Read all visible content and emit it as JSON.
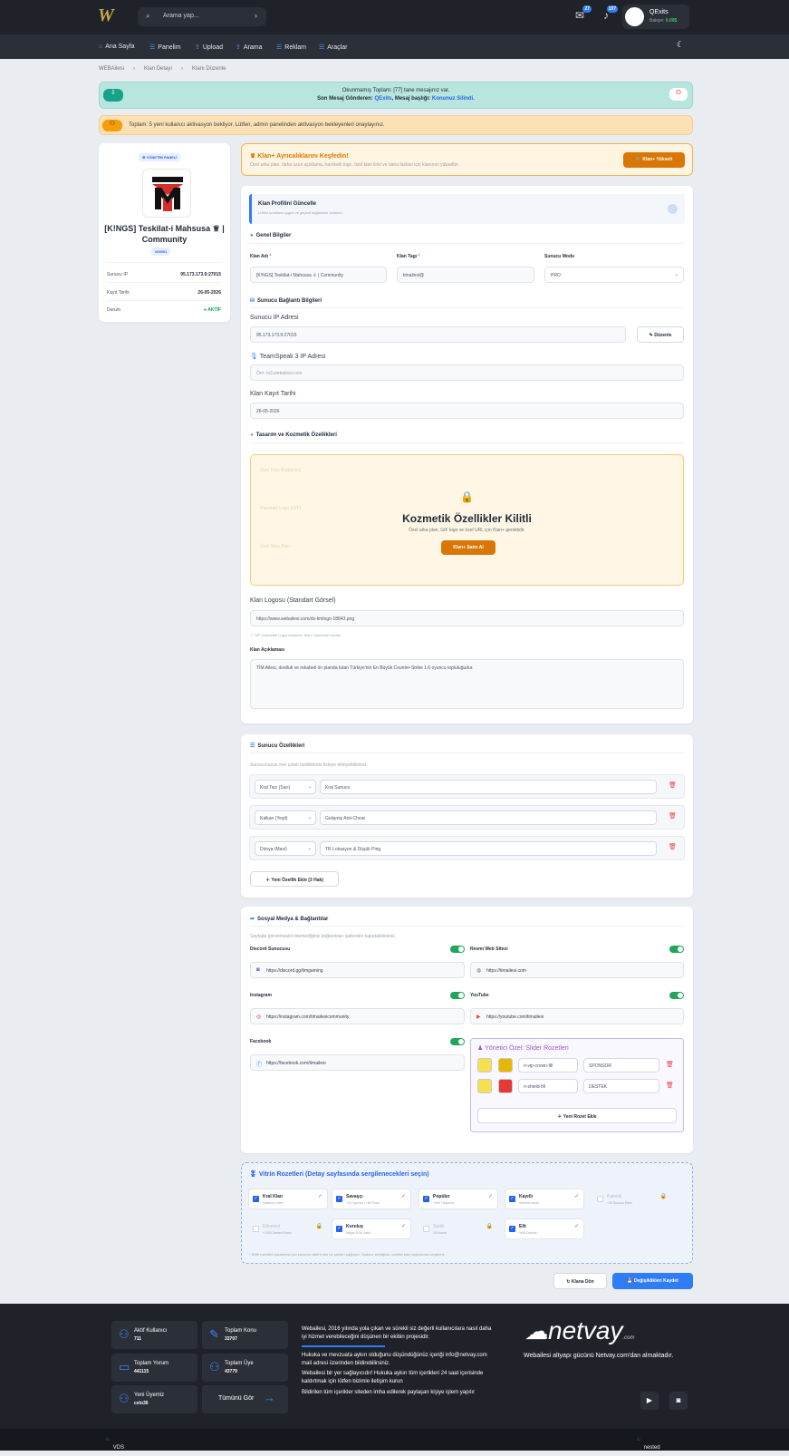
{
  "header": {
    "search_placeholder": "Arama yap...",
    "badge1": "27",
    "badge2": "197",
    "username": "QExits",
    "balance_label": "Bakiye:",
    "balance": "0.00$"
  },
  "nav": [
    "Ana Sayfa",
    "Panelim",
    "Upload",
    "Arama",
    "Reklam",
    "Araçlar"
  ],
  "breadcrumb": [
    "WEBAilesi",
    "Klan Detayı",
    "Klanı Düzenle"
  ],
  "alert_msg": {
    "line1": "Okunmamış Toplam: [77] tane mesajınız var.",
    "line2_prefix": "Son Mesaj Gönderen:",
    "sender": "QExits",
    "mid": ", Mesaj başlığı:",
    "title": "Konunuz Silindi."
  },
  "alert_activation": "Toplam: 5 yeni kullanıcı aktivasyon bekliyor. Lütfen, admin panelinden aktivasyon bekleyenleri onaylayınız.",
  "clan": {
    "panel_badge": "YÖNETİM PANELİ",
    "name": "[K!NGS] Teskilat-i Mahsusa ♕ | Community",
    "id_badge": "#00001",
    "rows": [
      {
        "k": "Sunucu IP",
        "v": "95.173.173.9:27015"
      },
      {
        "k": "Kayıt Tarihi",
        "v": "26-05-2026"
      },
      {
        "k": "Durum",
        "v": "AKTİF"
      }
    ]
  },
  "promo": {
    "title": "Klan+ Ayrıcalıklarını Keşfedin!",
    "sub": "Özel arka plan, daha uzun açıklama, hareketli logo, özel klan linki ve daha fazlası için klanınızı yükseltin.",
    "button": "Klan+ Yükselt"
  },
  "form": {
    "intro_title": "Klan Profilini Güncelle",
    "intro_sub": "Lütfen kurallara uygun ve geçerli bağlantılar kullanın.",
    "general": "Genel Bilgiler",
    "name_label": "Klan Adı",
    "name_value": "[K!NGS] Teskilat-i Mahsusa ♕ | Community",
    "tag_label": "Klan Tagı",
    "tag_value": "timailesi@",
    "mode_label": "Sunucu Modu",
    "mode_value": "PRO",
    "conn": "Sunucu Bağlantı Bilgileri",
    "ip_label": "Sunucu IP Adresi",
    "ip_value": "95.173.173.9:27015",
    "edit": "Düzenle",
    "ts_label": "TeamSpeak 3 IP Adresi",
    "ts_placeholder": "Örn: ts3.webailesi.com",
    "date_label": "Klan Kayıt Tarihi",
    "date_value": "26-05-2026",
    "design": "Tasarım ve Kozmetik Özellikleri",
    "ghost1": "Özel Klan Bağlantısı",
    "ghost2": "Hareketli Logo (GIF)",
    "ghost3": "Özel Arka Plan",
    "lock_title": "Kozmetik Özellikler Kilitli",
    "lock_sub": "Özel arka plan, GIF logo ve özel URL için Klan+ gereklidir.",
    "lock_button": "Klan+ Satın Al",
    "logo_label": "Klan Logosu (Standart Görsel)",
    "logo_value": "https://www.webailesi.com/ds-timlogo-18843.png",
    "logo_note": "ⓘ GIF (Hareketli Logo) kullanımı Klan+ üyelerine özeldir.",
    "desc_label": "Klan Açıklaması",
    "desc_value": "TİM Ailesi, dostluk ve rekabeti ön planda tutan Türkiye'nin En Büyük Counter-Strike 1.6 oyuncu topluluğudur."
  },
  "features": {
    "title": "Sunucu Özellikleri",
    "sub": "Sunucunuzun öne çıkan özelliklerini listeye ekleyebilirsiniz.",
    "items": [
      {
        "icon": "Kral Tacı (Sarı)",
        "text": "Kral Sunucu"
      },
      {
        "icon": "Kalkan (Yeşil)",
        "text": "Gelişmiş Anti-Cheat"
      },
      {
        "icon": "Dünya (Mavi)",
        "text": "TR Lokasyon & Düşük Ping"
      }
    ],
    "add": "Yeni Özellik Ekle (3 Hak)"
  },
  "social": {
    "title": "Sosyal Medya & Bağlantılar",
    "sub": "Sayfada görünmesini istemediğiniz bağlantıları şalterden kapatabilirsiniz.",
    "discord_label": "Discord Sunucusu",
    "discord": "https://discord.gg/timgaming",
    "web_label": "Resmi Web Sitesi",
    "web": "https://timailesi.com",
    "ig_label": "Instagram",
    "ig": "https://instagram.com/timailesicommunity",
    "yt_label": "YouTube",
    "yt": "https://youtube.com/timailesi",
    "fb_label": "Facebook",
    "fb": "https://facebook.com/timailesi",
    "admin_title": "Yönetici Özel: Slider Rozetleri",
    "badges": [
      {
        "icon": "ri-vip-crown-fill",
        "label": "SPONSOR",
        "c1": "#f5e050",
        "c2": "#e5b800"
      },
      {
        "icon": "ri-shield-fill",
        "label": "DESTEK",
        "c1": "#f5e050",
        "c2": "#e53935"
      }
    ],
    "add_badge": "Yeni Rozet Ekle"
  },
  "vitrin": {
    "title": "Vitrin Rozetleri (Detay sayfasında sergilenecekleri seçin)",
    "items": [
      {
        "n": "Kral Klan",
        "d": "Haftanın Lideri",
        "on": true
      },
      {
        "n": "Savaşçı",
        "d": "+20 Oyuncu / +80 Puan",
        "on": true
      },
      {
        "n": "Popüler",
        "d": "+900 Tıklanma",
        "on": true
      },
      {
        "n": "Kayıtlı",
        "d": "Sisteme tanıtıl",
        "on": true
      },
      {
        "n": "Kalemli",
        "d": "+40 Sunucu Etkin",
        "on": false
      },
      {
        "n": "Efsanevi",
        "d": "+1000 Destek Puanı",
        "on": false
      },
      {
        "n": "Kuruluş",
        "d": "Mayıs 2026 Sabit",
        "on": true
      },
      {
        "n": "Sadık",
        "d": "18 Kurum",
        "on": false
      },
      {
        "n": "Elit",
        "d": "%95 Doluluk",
        "on": true
      }
    ],
    "note": "* Kilitli rozetleri kazanmak için klanınızı aktif tutun ve şartları sağlayın. Sadece seçtiğiniz rozetler klan sayfanızda sergilenir."
  },
  "actions": {
    "back": "Klana Dön",
    "save": "Değişiklikleri Kaydet"
  },
  "footer": {
    "stats": [
      {
        "l": "Aktif Kullanıcı",
        "v": "711"
      },
      {
        "l": "Toplam Konu",
        "v": "33707"
      },
      {
        "l": "Toplam Yorum",
        "v": "441115"
      },
      {
        "l": "Toplam Üye",
        "v": "43779"
      },
      {
        "l": "Yeni Üyemiz",
        "v": "celo36"
      }
    ],
    "see_all": "Tümünü Gör",
    "p1": "Webailesi, 2016 yılında yola çıkan ve sürekli siz değerli kullanıcılara nasıl daha iyi hizmet verebileceğini düşünen bir ekibin projesidir.",
    "p2": "Hukuka ve mevzuata aykırı olduğunu düşündüğünüz içeriği info@netvay.com mail adresi üzerinden bildirebilirsiniz.",
    "p3": "Webailesi bir yer sağlayıcıdır! Hukuka aykırı tüm içerikleri 24 saat içerisinde kaldırtmak için lütfen bizimle iletişim kurun",
    "p4": "Bildirilen tüm içerikler siteden imha edilerek paylaşan kişiye işlem yapılır",
    "brand": "netvay",
    "brand_sub": ".com",
    "brand_text": "Webailesi altyapı gücünü Netvay.com'dan almaktadır.",
    "left_link": "VDS",
    "right_link": "nested sunucu"
  },
  "colors": {
    "accent": "#2f7df6",
    "orange": "#d97706",
    "green": "#22a55a",
    "dark": "#1f2329"
  }
}
